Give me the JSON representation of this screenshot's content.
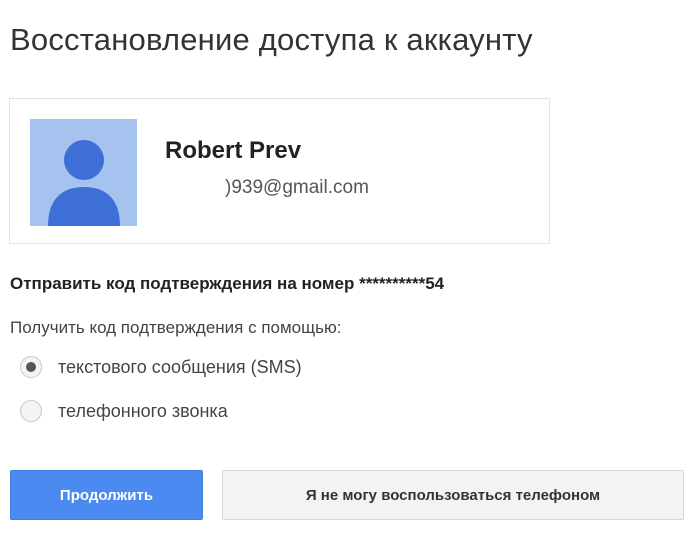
{
  "page": {
    "title": "Восстановление доступа к аккаунту"
  },
  "account": {
    "name": "Robert Prev",
    "email": ")939@gmail.com",
    "avatar_icon": "user-silhouette-icon",
    "avatar_bg_color": "#a6c3ef",
    "avatar_fg_color": "#3d6fd6"
  },
  "verification": {
    "send_code_text": "Отправить код подтверждения на номер **********54",
    "receive_label": "Получить код подтверждения с помощью:",
    "options": [
      {
        "label": "текстового сообщения (SMS)",
        "selected": true
      },
      {
        "label": "телефонного звонка",
        "selected": false
      }
    ]
  },
  "actions": {
    "continue_label": "Продолжить",
    "no_phone_label": "Я не могу воспользоваться телефоном",
    "primary_color": "#4a8af1"
  }
}
